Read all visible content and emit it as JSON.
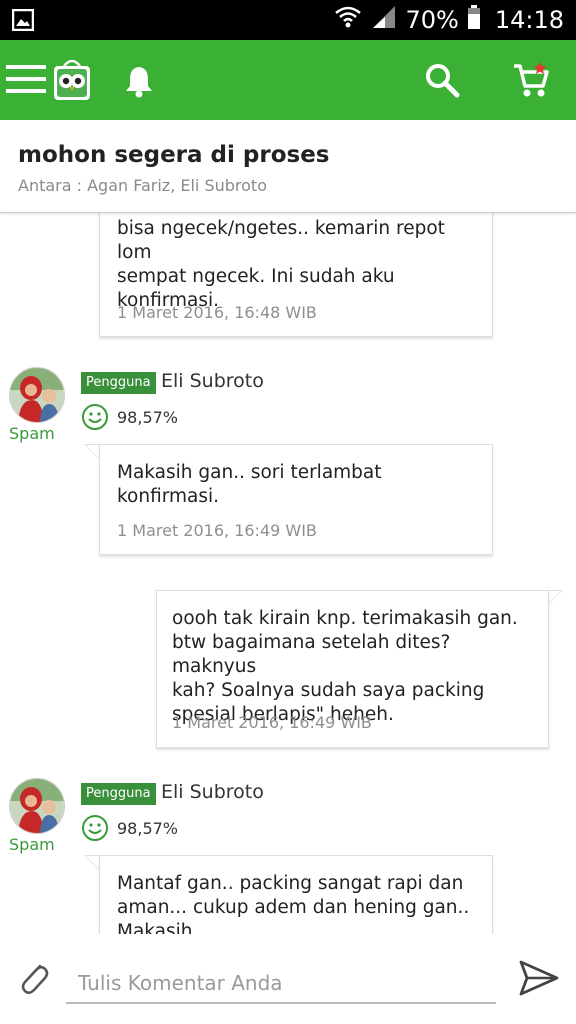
{
  "status_bar": {
    "battery": "70%",
    "time": "14:18",
    "icons": [
      "gallery-icon",
      "wifi-icon",
      "signal-icon",
      "battery-icon"
    ]
  },
  "app_bar": {
    "icons": [
      "menu-icon",
      "owl-logo-icon",
      "bell-icon",
      "search-icon",
      "cart-icon"
    ],
    "accent_color": "#3ab134"
  },
  "thread": {
    "title": "mohon segera di proses",
    "participants": "Antara : Agan Fariz, Eli Subroto"
  },
  "messages": [
    {
      "side": "left",
      "lines": [
        "bisa ngecek/ngetes.. kemarin repot lom",
        "sempat ngecek. Ini sudah aku",
        "konfirmasi."
      ],
      "time": "1 Maret 2016, 16:48 WIB"
    },
    {
      "side": "left",
      "sender": "Eli Subroto",
      "role": "Pengguna",
      "rating": "98,57%",
      "spam_label": "Spam",
      "lines": [
        "Makasih gan.. sori terlambat",
        "konfirmasi."
      ],
      "time": "1 Maret 2016, 16:49 WIB"
    },
    {
      "side": "right",
      "lines": [
        "oooh tak kirain knp. terimakasih gan.",
        "btw bagaimana setelah dites? maknyus",
        "kah? Soalnya sudah saya packing",
        "spesial berlapis\" heheh."
      ],
      "time": "1 Maret 2016, 16:49 WIB"
    },
    {
      "side": "left",
      "sender": "Eli Subroto",
      "role": "Pengguna",
      "rating": "98,57%",
      "spam_label": "Spam",
      "lines": [
        "Mantaf gan.. packing sangat rapi dan",
        "aman... cukup adem dan hening gan..",
        "Makasih"
      ]
    }
  ],
  "composer": {
    "placeholder": "Tulis Komentar Anda",
    "value": "",
    "icons": [
      "paperclip-icon",
      "send-icon"
    ]
  }
}
